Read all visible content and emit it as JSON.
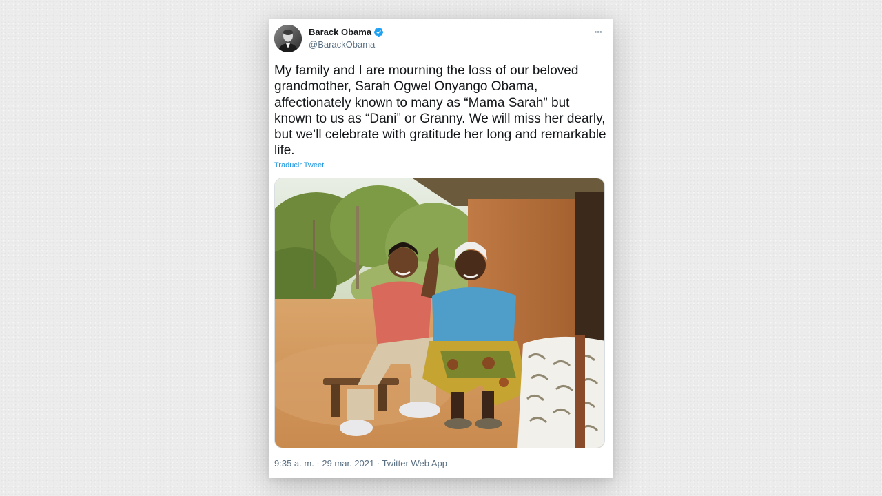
{
  "tweet": {
    "display_name": "Barack Obama",
    "handle": "@BarackObama",
    "more_label": "···",
    "text": "My family and I are mourning the loss of our beloved grandmother, Sarah Ogwel Onyango Obama, affectionately known to many as “Mama Sarah” but known to us as “Dani” or Granny. We will miss her dearly, but we’ll celebrate with gratitude her long and remarkable life.",
    "translate_label": "Traducir Tweet",
    "meta": "9:35 a. m. · 29 mar. 2021 · Twitter Web App",
    "verified_icon": "verified-badge-icon",
    "avatar_icon": "user-avatar",
    "photo_description_icon": "photo"
  },
  "colors": {
    "background": "#ececec",
    "card": "#ffffff",
    "text": "#14171a",
    "secondary_text": "#5b7083",
    "link": "#1b95e0",
    "verified": "#1da1f2"
  }
}
